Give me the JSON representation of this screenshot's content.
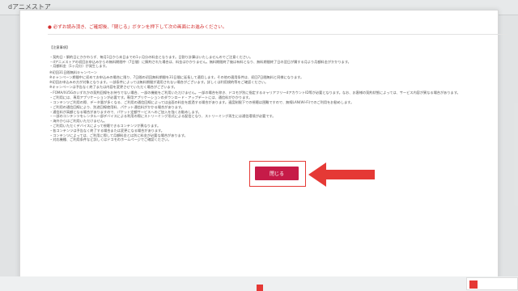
{
  "app": {
    "title": "dアニメストア"
  },
  "modal": {
    "notice": "● 必ずお読み頂き、ご確認後、「閉じる」ボタンを押下して次の画面にお進みください。",
    "heading": "【注意事項】",
    "lines": [
      "・契約日・解約日にかかわらず、毎月1日から末日までの1ヶ月分の料金となります。日割り計算はいたしませんのでご注意ください。",
      "・dアニメストアの初回お申込みからの無料期間中（7日間）に解約された場合は、料金はかかりません。無料期間終了後は有料となり、無料期間終了日の翌日が属する月より月額料金がかかります。",
      "・月額料金（1ヶ月分）が発生します。",
      "※初回31日間無料キャンペーン",
      "※キャンペーン期間中に初めてお申込みの場合に限り、7日間の初回無料期間を31日間に延長して適用します。その他の適用条件は、初回7日間無料と同様になります。",
      "※初回お申込みの方が対象となります。一部条件によっては無料期間が適用されない場合がございます。詳しくは利用規約等をご確認ください。",
      "※キャンペーンは予告なく終了または内容を変更させていただく場合がございます。",
      "・FOMA/Xi/5Gのいずれかの契約回線をお持ちでない場合、一部の機能をご利用いただけません。一部の場合を除き、ドコモが別に指定するキャリアフリーdアカウントID等が必要となります。なお、お客様の契約状態によっては、サービス内容が異なる場合があります。",
      "・ご利用には、専用アプリケーションが必要です。専用アプリケーションのダウンロード・アップデートには、通信料がかかります。",
      "・コンテンツご利用の際、データ量が多くなる、ご利用の通信回線によっては出面の料金を超過する場合があります。速度制限下での視聴は困難ですので、無線LAN(Wi-Fi)でのご利用をお勧めします。",
      "・ご利用の通信回線により、別途回線使用料、パケット通信料がかかる場合があります。",
      "・通信料が高額となる場合がありますので、パケット定額サービスへのご加入を強くお勧めします。",
      "・一部のコンテンツをレンタル一部デバイスによる利用の際にストリーミング形式による配信となり、ストリーミング再生には通信環境が必要です。",
      "・海外からはご利用いただけません。",
      "・ご利用いただくデバイスによって視聴できるコンテンツが異なります。",
      "・各コンテンツは予告なく終了する場合または変更になる場合があります。",
      "・コンテンツによっては、ご利用に際して月額料金とは別に料金が必要な場合があります。",
      "・対応機種、ご利用条件など詳しくはドコモのホームページでご確認ください。"
    ],
    "close_label": "閉じる"
  },
  "colors": {
    "accent": "#c61b48",
    "highlight": "#e53935",
    "notice_text": "#d32f2f"
  },
  "icons": {
    "arrow": "arrow-left-icon"
  }
}
